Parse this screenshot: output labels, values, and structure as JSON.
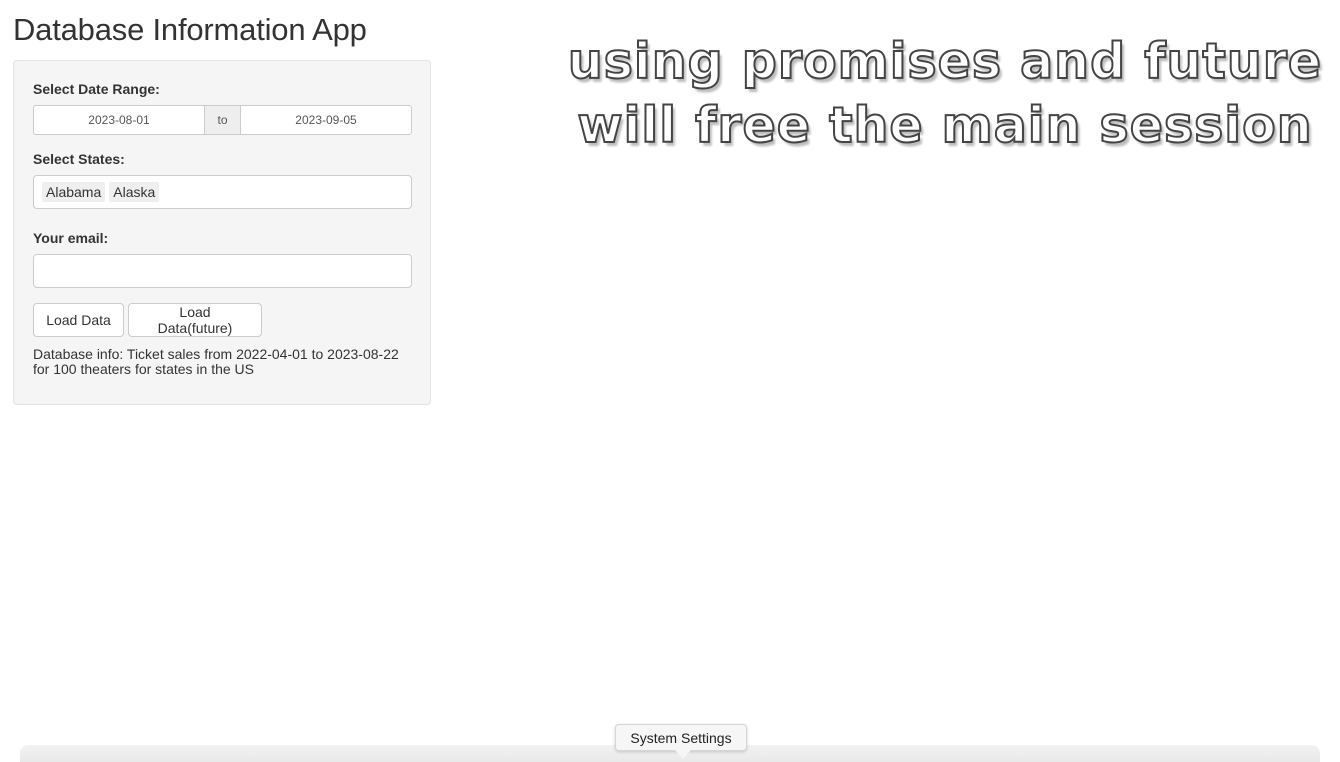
{
  "app": {
    "title": "Database Information App"
  },
  "sidebar": {
    "date_range": {
      "label": "Select Date Range:",
      "start": "2023-08-01",
      "separator": "to",
      "end": "2023-09-05"
    },
    "states": {
      "label": "Select States:",
      "selected": [
        "Alabama",
        "Alaska"
      ]
    },
    "email": {
      "label": "Your email:",
      "value": ""
    },
    "buttons": {
      "load_data": "Load Data",
      "load_data_future": "Load Data(future)"
    },
    "db_info": "Database info: Ticket sales from 2022-04-01 to 2023-08-22 for 100 theaters for states in the US"
  },
  "overlay": {
    "line1": "using promises and future",
    "line2": "will free the main session"
  },
  "system": {
    "tooltip": "System Settings"
  },
  "colors": {
    "panel_bg": "#f5f5f5",
    "panel_border": "#e3e3e3",
    "text": "#333333",
    "chip_bg": "#efefef"
  }
}
